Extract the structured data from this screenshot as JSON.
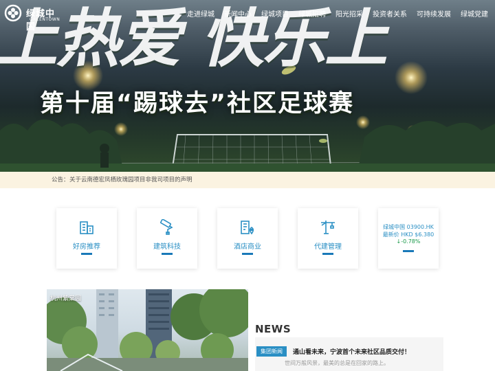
{
  "header": {
    "logo_text": "绿城中国",
    "logo_sub": "GREENTOWN",
    "nav": [
      "走进绿城",
      "新闻中心",
      "绿城项目",
      "绿城招聘",
      "阳光招采",
      "投资者关系",
      "可持续发展",
      "绿城党建"
    ]
  },
  "hero": {
    "big_text": "上热爱 快乐上",
    "title": "第十届“踢球去”社区足球赛"
  },
  "notice": {
    "label": "公告：",
    "text": "关于云南德宏凤栖玫瑰园项目非我司项目的声明"
  },
  "cards": [
    {
      "label": "好房推荐",
      "icon": "building-icon"
    },
    {
      "label": "建筑科技",
      "icon": "paint-roller-icon"
    },
    {
      "label": "酒店商业",
      "icon": "hotel-location-icon"
    },
    {
      "label": "代建管理",
      "icon": "crane-icon"
    }
  ],
  "stock": {
    "line1": "绿城中国 03900.HK",
    "line2": "最新价 HKD $6.380",
    "change": "↓-0.78%"
  },
  "project": {
    "label": "杭州紫棠园"
  },
  "news": {
    "title": "NEWS",
    "tag": "集团新闻",
    "headline": "通山看未来，宁波首个未来社区品质交付！",
    "sub": "世间万般风景，最美的总是在回家的路上。"
  },
  "colors": {
    "accent": "#2a8fc4",
    "bar": "#1979b8",
    "notice_bg": "#fbf3e1",
    "stock_down": "#1a9a4a"
  }
}
